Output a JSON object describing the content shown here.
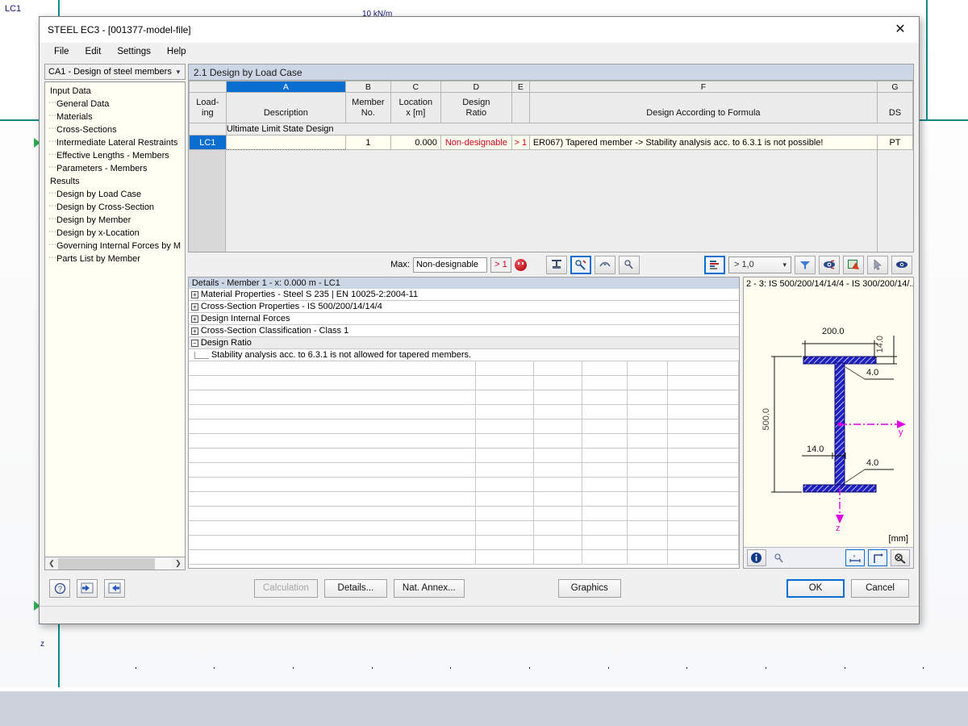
{
  "background": {
    "load_case_label": "LC1",
    "load_value": "10 kN/m",
    "axis_z_label": "z"
  },
  "window": {
    "title": "STEEL EC3 - [001377-model-file]",
    "close_icon": "close-icon",
    "menu": [
      "File",
      "Edit",
      "Settings",
      "Help"
    ]
  },
  "nav": {
    "combo_value": "CA1 - Design of steel members",
    "combo_caret": "chevron-down-icon",
    "tree": [
      {
        "label": "Input Data",
        "level": 0,
        "selected": false
      },
      {
        "label": "General Data",
        "level": 1,
        "selected": false
      },
      {
        "label": "Materials",
        "level": 1,
        "selected": false
      },
      {
        "label": "Cross-Sections",
        "level": 1,
        "selected": false
      },
      {
        "label": "Intermediate Lateral Restraints",
        "level": 1,
        "selected": false
      },
      {
        "label": "Effective Lengths - Members",
        "level": 1,
        "selected": false
      },
      {
        "label": "Parameters - Members",
        "level": 1,
        "selected": false
      },
      {
        "label": "Results",
        "level": 0,
        "selected": false
      },
      {
        "label": "Design by Load Case",
        "level": 1,
        "selected": true
      },
      {
        "label": "Design by Cross-Section",
        "level": 1,
        "selected": false
      },
      {
        "label": "Design by Member",
        "level": 1,
        "selected": false
      },
      {
        "label": "Design by x-Location",
        "level": 1,
        "selected": false
      },
      {
        "label": "Governing Internal Forces by M",
        "level": 1,
        "selected": false
      },
      {
        "label": "Parts List by Member",
        "level": 1,
        "selected": false
      }
    ],
    "scroll_left_icon": "chevron-left-icon",
    "scroll_right_icon": "chevron-right-icon"
  },
  "section": {
    "header": "2.1 Design by Load Case"
  },
  "results_table": {
    "column_letters": [
      "",
      "A",
      "B",
      "C",
      "D",
      "E",
      "F",
      "G"
    ],
    "active_column": "A",
    "headers": [
      "Load-\ning",
      "Description",
      "Member\nNo.",
      "Location\nx [m]",
      "Design\nRatio",
      "",
      "Design According to Formula",
      "DS"
    ],
    "headers_flat": {
      "loading_1": "Load-",
      "loading_2": "ing",
      "description": "Description",
      "member_1": "Member",
      "member_2": "No.",
      "location_1": "Location",
      "location_2": "x [m]",
      "ratio_1": "Design",
      "ratio_2": "Ratio",
      "formula": "Design According to Formula",
      "ds": "DS"
    },
    "group_row": "Ultimate Limit State Design",
    "rows": [
      {
        "loading": "LC1",
        "description": "",
        "member_no": "1",
        "location": "0.000",
        "design_ratio": "Non-designable",
        "ratio_flag": "> 1",
        "formula": "ER067) Tapered member -> Stability analysis acc. to 6.3.1 is not possible!",
        "ds": "PT"
      }
    ]
  },
  "toolbar": {
    "max_label": "Max:",
    "max_value": "Non-designable",
    "max_ratio": "> 1",
    "status_icon": "sad-face-icon",
    "buttons": [
      {
        "name": "cross-section-values-icon",
        "active": false
      },
      {
        "name": "result-diagram-icon",
        "active": true
      },
      {
        "name": "print-preview-icon",
        "active": false
      },
      {
        "name": "color-pick-icon",
        "active": false
      }
    ],
    "right_buttons": [
      {
        "name": "filter-rows-icon",
        "active": true
      }
    ],
    "ratio_filter": "> 1,0",
    "ratio_filter_caret": "chevron-down-icon",
    "tools": [
      {
        "name": "funnel-filter-icon"
      },
      {
        "name": "view-settings-icon"
      },
      {
        "name": "export-excel-icon"
      },
      {
        "name": "select-pointer-icon"
      },
      {
        "name": "visibility-eye-icon"
      }
    ]
  },
  "details": {
    "header": "Details - Member 1 - x: 0.000 m - LC1",
    "items": [
      {
        "expander": "+",
        "label": "Material Properties - Steel S 235 | EN 10025-2:2004-11",
        "grey": false
      },
      {
        "expander": "+",
        "label": "Cross-Section Properties  -  IS 500/200/14/14/4",
        "grey": false
      },
      {
        "expander": "+",
        "label": "Design Internal Forces",
        "grey": false
      },
      {
        "expander": "+",
        "label": "Cross-Section Classification - Class 1",
        "grey": false
      },
      {
        "expander": "−",
        "label": "Design Ratio",
        "grey": true
      }
    ],
    "leaf": "Stability analysis acc. to 6.3.1 is not allowed for tapered members."
  },
  "graphic": {
    "header": "2 - 3: IS 500/200/14/14/4 - IS 300/200/14/..",
    "units": "[mm]",
    "dimensions": {
      "flange_width": "200.0",
      "flange_thickness_top": "14.0",
      "web_fillet_top": "4.0",
      "section_height": "500.0",
      "web_thickness": "14.0",
      "web_fillet_bottom": "4.0"
    },
    "axis_y": "y",
    "axis_z": "z",
    "tools": [
      {
        "name": "info-icon",
        "active": false
      },
      {
        "name": "color-pick-icon",
        "active": false
      },
      {
        "name": "show-dimensions-icon",
        "active": true
      },
      {
        "name": "show-axes-icon",
        "active": true
      },
      {
        "name": "zoom-reset-icon",
        "active": false
      }
    ]
  },
  "footer": {
    "help_icon": "help-icon",
    "prev_icon": "go-previous-icon",
    "next_icon": "go-next-icon",
    "calculation": "Calculation",
    "details": "Details...",
    "nat_annex": "Nat. Annex...",
    "graphics": "Graphics",
    "ok": "OK",
    "cancel": "Cancel"
  }
}
